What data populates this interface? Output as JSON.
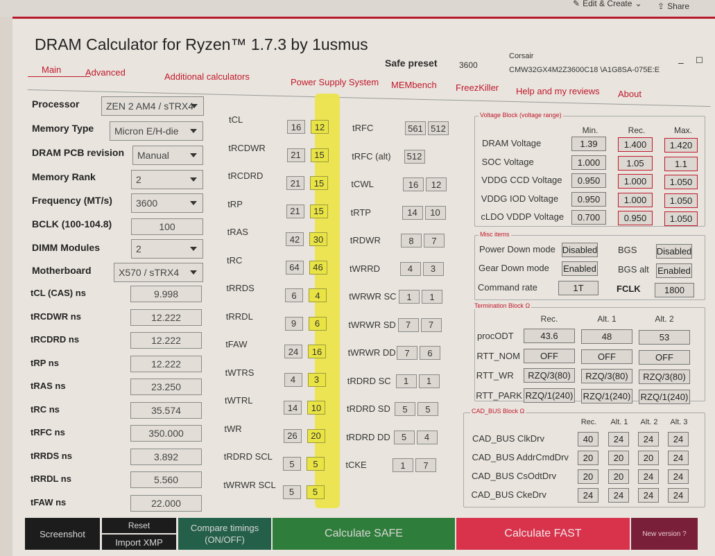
{
  "shell": {
    "edit_create": "Edit & Create",
    "share": "Share"
  },
  "app": {
    "title": "DRAM Calculator for Ryzen™ 1.7.3 by 1usmus",
    "safe_preset_label": "Safe preset",
    "safe_preset_value": "3600",
    "memory_vendor": "Corsair",
    "memory_part": "CMW32GX4M2Z3600C18 \\A1G8SA-075E:E"
  },
  "nav": [
    "Main",
    "Advanced",
    "Additional calculators",
    "Power Supply System",
    "MEMbench",
    "FreezKiller",
    "Help and my reviews",
    "About"
  ],
  "left": {
    "processor_label": "Processor",
    "processor_value": "ZEN 2 AM4 / sTRX4",
    "memtype_label": "Memory Type",
    "memtype_value": "Micron E/H-die",
    "pcb_label": "DRAM PCB revision",
    "pcb_value": "Manual",
    "rank_label": "Memory Rank",
    "rank_value": "2",
    "freq_label": "Frequency (MT/s)",
    "freq_value": "3600",
    "bclk_label": "BCLK (100-104.8)",
    "bclk_value": "100",
    "dimm_label": "DIMM Modules",
    "dimm_value": "2",
    "mobo_label": "Motherboard",
    "mobo_value": "X570 / sTRX4",
    "ns": [
      {
        "label": "tCL (CAS) ns",
        "value": "9.998"
      },
      {
        "label": "tRCDWR ns",
        "value": "12.222"
      },
      {
        "label": "tRCDRD ns",
        "value": "12.222"
      },
      {
        "label": "tRP ns",
        "value": "12.222"
      },
      {
        "label": "tRAS ns",
        "value": "23.250"
      },
      {
        "label": "tRC ns",
        "value": "35.574"
      },
      {
        "label": "tRFC ns",
        "value": "350.000"
      },
      {
        "label": "tRRDS ns",
        "value": "3.892"
      },
      {
        "label": "tRRDL ns",
        "value": "5.560"
      },
      {
        "label": "tFAW ns",
        "value": "22.000"
      }
    ]
  },
  "timings_a": [
    {
      "name": "tCL",
      "a": "16",
      "b": "12"
    },
    {
      "name": "tRCDWR",
      "a": "21",
      "b": "15"
    },
    {
      "name": "tRCDRD",
      "a": "21",
      "b": "15"
    },
    {
      "name": "tRP",
      "a": "21",
      "b": "15"
    },
    {
      "name": "tRAS",
      "a": "42",
      "b": "30"
    },
    {
      "name": "tRC",
      "a": "64",
      "b": "46"
    },
    {
      "name": "tRRDS",
      "a": "6",
      "b": "4"
    },
    {
      "name": "tRRDL",
      "a": "9",
      "b": "6"
    },
    {
      "name": "tFAW",
      "a": "24",
      "b": "16"
    },
    {
      "name": "tWTRS",
      "a": "4",
      "b": "3"
    },
    {
      "name": "tWTRL",
      "a": "14",
      "b": "10"
    },
    {
      "name": "tWR",
      "a": "26",
      "b": "20"
    },
    {
      "name": "tRDRD SCL",
      "a": "5",
      "b": "5"
    },
    {
      "name": "tWRWR SCL",
      "a": "5",
      "b": "5"
    }
  ],
  "timings_b": [
    {
      "name": "tRFC",
      "a": "561",
      "b": "512"
    },
    {
      "name": "tRFC (alt)",
      "a": "512",
      "b": ""
    },
    {
      "name": "tCWL",
      "a": "16",
      "b": "12"
    },
    {
      "name": "tRTP",
      "a": "14",
      "b": "10"
    },
    {
      "name": "tRDWR",
      "a": "8",
      "b": "7"
    },
    {
      "name": "tWRRD",
      "a": "4",
      "b": "3"
    },
    {
      "name": "tWRWR SC",
      "a": "1",
      "b": "1"
    },
    {
      "name": "tWRWR SD",
      "a": "7",
      "b": "7"
    },
    {
      "name": "tWRWR DD",
      "a": "7",
      "b": "6"
    },
    {
      "name": "tRDRD SC",
      "a": "1",
      "b": "1"
    },
    {
      "name": "tRDRD SD",
      "a": "5",
      "b": "5"
    },
    {
      "name": "tRDRD DD",
      "a": "5",
      "b": "4"
    },
    {
      "name": "tCKE",
      "a": "1",
      "b": "7"
    }
  ],
  "voltage": {
    "title": "Voltage Block (voltage range)",
    "headers": [
      "Min.",
      "Rec.",
      "Max."
    ],
    "rows": [
      {
        "label": "DRAM Voltage",
        "min": "1.39",
        "rec": "1.400",
        "max": "1.420"
      },
      {
        "label": "SOC Voltage",
        "min": "1.000",
        "rec": "1.05",
        "max": "1.1"
      },
      {
        "label": "VDDG  CCD Voltage",
        "min": "0.950",
        "rec": "1.000",
        "max": "1.050"
      },
      {
        "label": "VDDG  IOD Voltage",
        "min": "0.950",
        "rec": "1.000",
        "max": "1.050"
      },
      {
        "label": "cLDO VDDP Voltage",
        "min": "0.700",
        "rec": "0.950",
        "max": "1.050"
      }
    ]
  },
  "misc": {
    "title": "Misc items",
    "power_down_label": "Power Down mode",
    "power_down_value": "Disabled",
    "bgs_label": "BGS",
    "bgs_value": "Disabled",
    "gear_down_label": "Gear Down mode",
    "gear_down_value": "Enabled",
    "bgs_alt_label": "BGS alt",
    "bgs_alt_value": "Enabled",
    "cmd_rate_label": "Command rate",
    "cmd_rate_value": "1T",
    "fclk_label": "FCLK",
    "fclk_value": "1800"
  },
  "termination": {
    "title": "Termination Block Ω",
    "headers": [
      "Rec.",
      "Alt. 1",
      "Alt. 2"
    ],
    "rows": [
      {
        "label": "procODT",
        "v": [
          "43.6",
          "48",
          "53"
        ]
      },
      {
        "label": "RTT_NOM",
        "v": [
          "OFF",
          "OFF",
          "OFF"
        ]
      },
      {
        "label": "RTT_WR",
        "v": [
          "RZQ/3(80)",
          "RZQ/3(80)",
          "RZQ/3(80)"
        ]
      },
      {
        "label": "RTT_PARK",
        "v": [
          "RZQ/1(240)",
          "RZQ/1(240)",
          "RZQ/1(240)"
        ]
      }
    ]
  },
  "cadbus": {
    "title": "CAD_BUS Block Ω",
    "headers": [
      "Rec.",
      "Alt. 1",
      "Alt. 2",
      "Alt. 3"
    ],
    "rows": [
      {
        "label": "CAD_BUS ClkDrv",
        "v": [
          "40",
          "24",
          "24",
          "24"
        ]
      },
      {
        "label": "CAD_BUS AddrCmdDrv",
        "v": [
          "20",
          "20",
          "20",
          "24"
        ]
      },
      {
        "label": "CAD_BUS CsOdtDrv",
        "v": [
          "20",
          "20",
          "24",
          "24"
        ]
      },
      {
        "label": "CAD_BUS CkeDrv",
        "v": [
          "24",
          "24",
          "24",
          "24"
        ]
      }
    ]
  },
  "buttons": {
    "screenshot": "Screenshot",
    "reset": "Reset",
    "import_xmp": "Import XMP",
    "compare": "Compare timings (ON/OFF)",
    "calc_safe": "Calculate SAFE",
    "calc_fast": "Calculate FAST",
    "new_version": "New version ?"
  },
  "colors": {
    "accent": "#c0182c",
    "highlight": "#ece44a",
    "safe": "#2f7d3a",
    "fast": "#d9334c"
  }
}
